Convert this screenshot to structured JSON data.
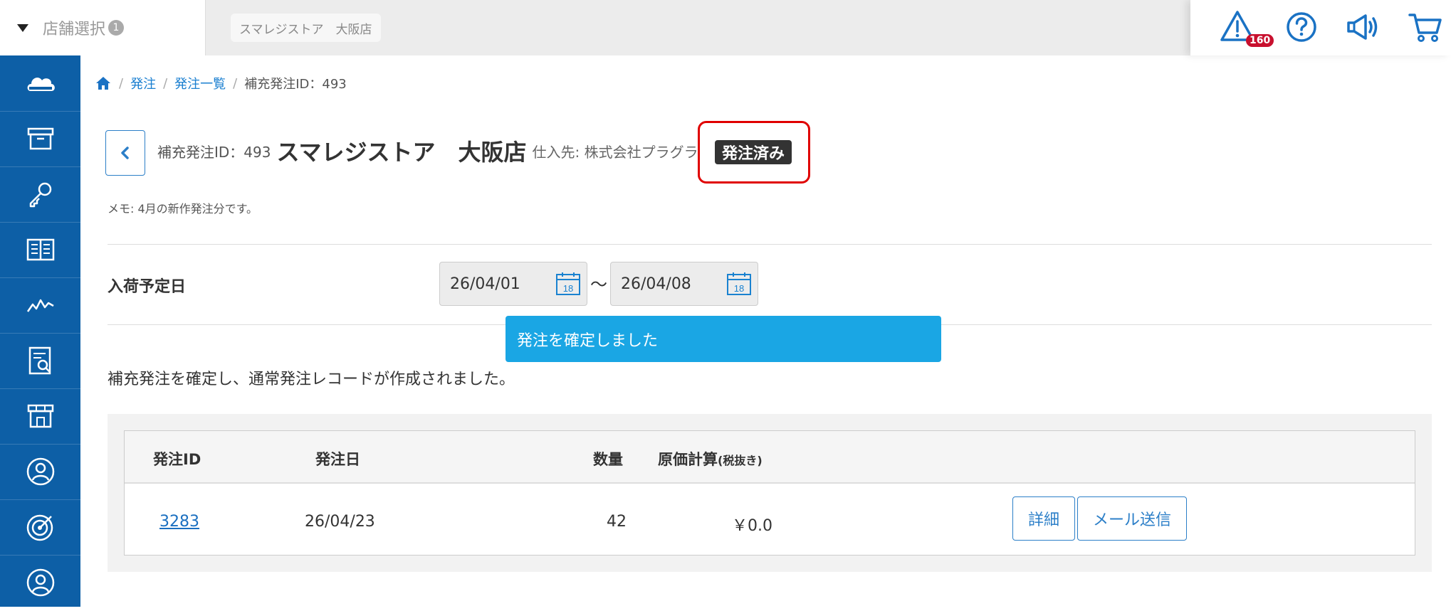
{
  "topbar": {
    "store_select_label": "店舗選択",
    "store_select_count": "1",
    "current_store_chip": "スマレジストア　大阪店",
    "alert_badge": "160"
  },
  "breadcrumb": {
    "home": "home-icon",
    "items": [
      "発注",
      "発注一覧"
    ],
    "current": "補充発注ID：493"
  },
  "header": {
    "id_label": "補充発注ID：493",
    "store_name": "スマレジストア　大阪店",
    "supplier": "仕入先: 株式会社プラグラ",
    "status": "発注済み"
  },
  "memo": "メモ: 4月の新作発注分です。",
  "arrival": {
    "label": "入荷予定日",
    "from": "26/04/01",
    "to": "26/04/08",
    "tilde": "〜",
    "calendar_day": "18"
  },
  "toast": "発注を確定しました",
  "message": "補充発注を確定し、通常発注レコードが作成されました。",
  "table": {
    "headers": {
      "order_id": "発注ID",
      "order_date": "発注日",
      "quantity": "数量",
      "cost": "原価計算",
      "cost_note": "(税抜き)"
    },
    "rows": [
      {
        "order_id": "3283",
        "order_date": "26/04/23",
        "quantity": "42",
        "cost": "￥0.0",
        "detail_button": "詳細",
        "mail_button": "メール送信"
      }
    ]
  },
  "colors": {
    "sidebar": "#0d5fa6",
    "accent": "#2c7fc8",
    "toast": "#1aa6e4",
    "status_badge": "#333333",
    "highlight": "#e00000",
    "alert_badge": "#c8102e"
  }
}
